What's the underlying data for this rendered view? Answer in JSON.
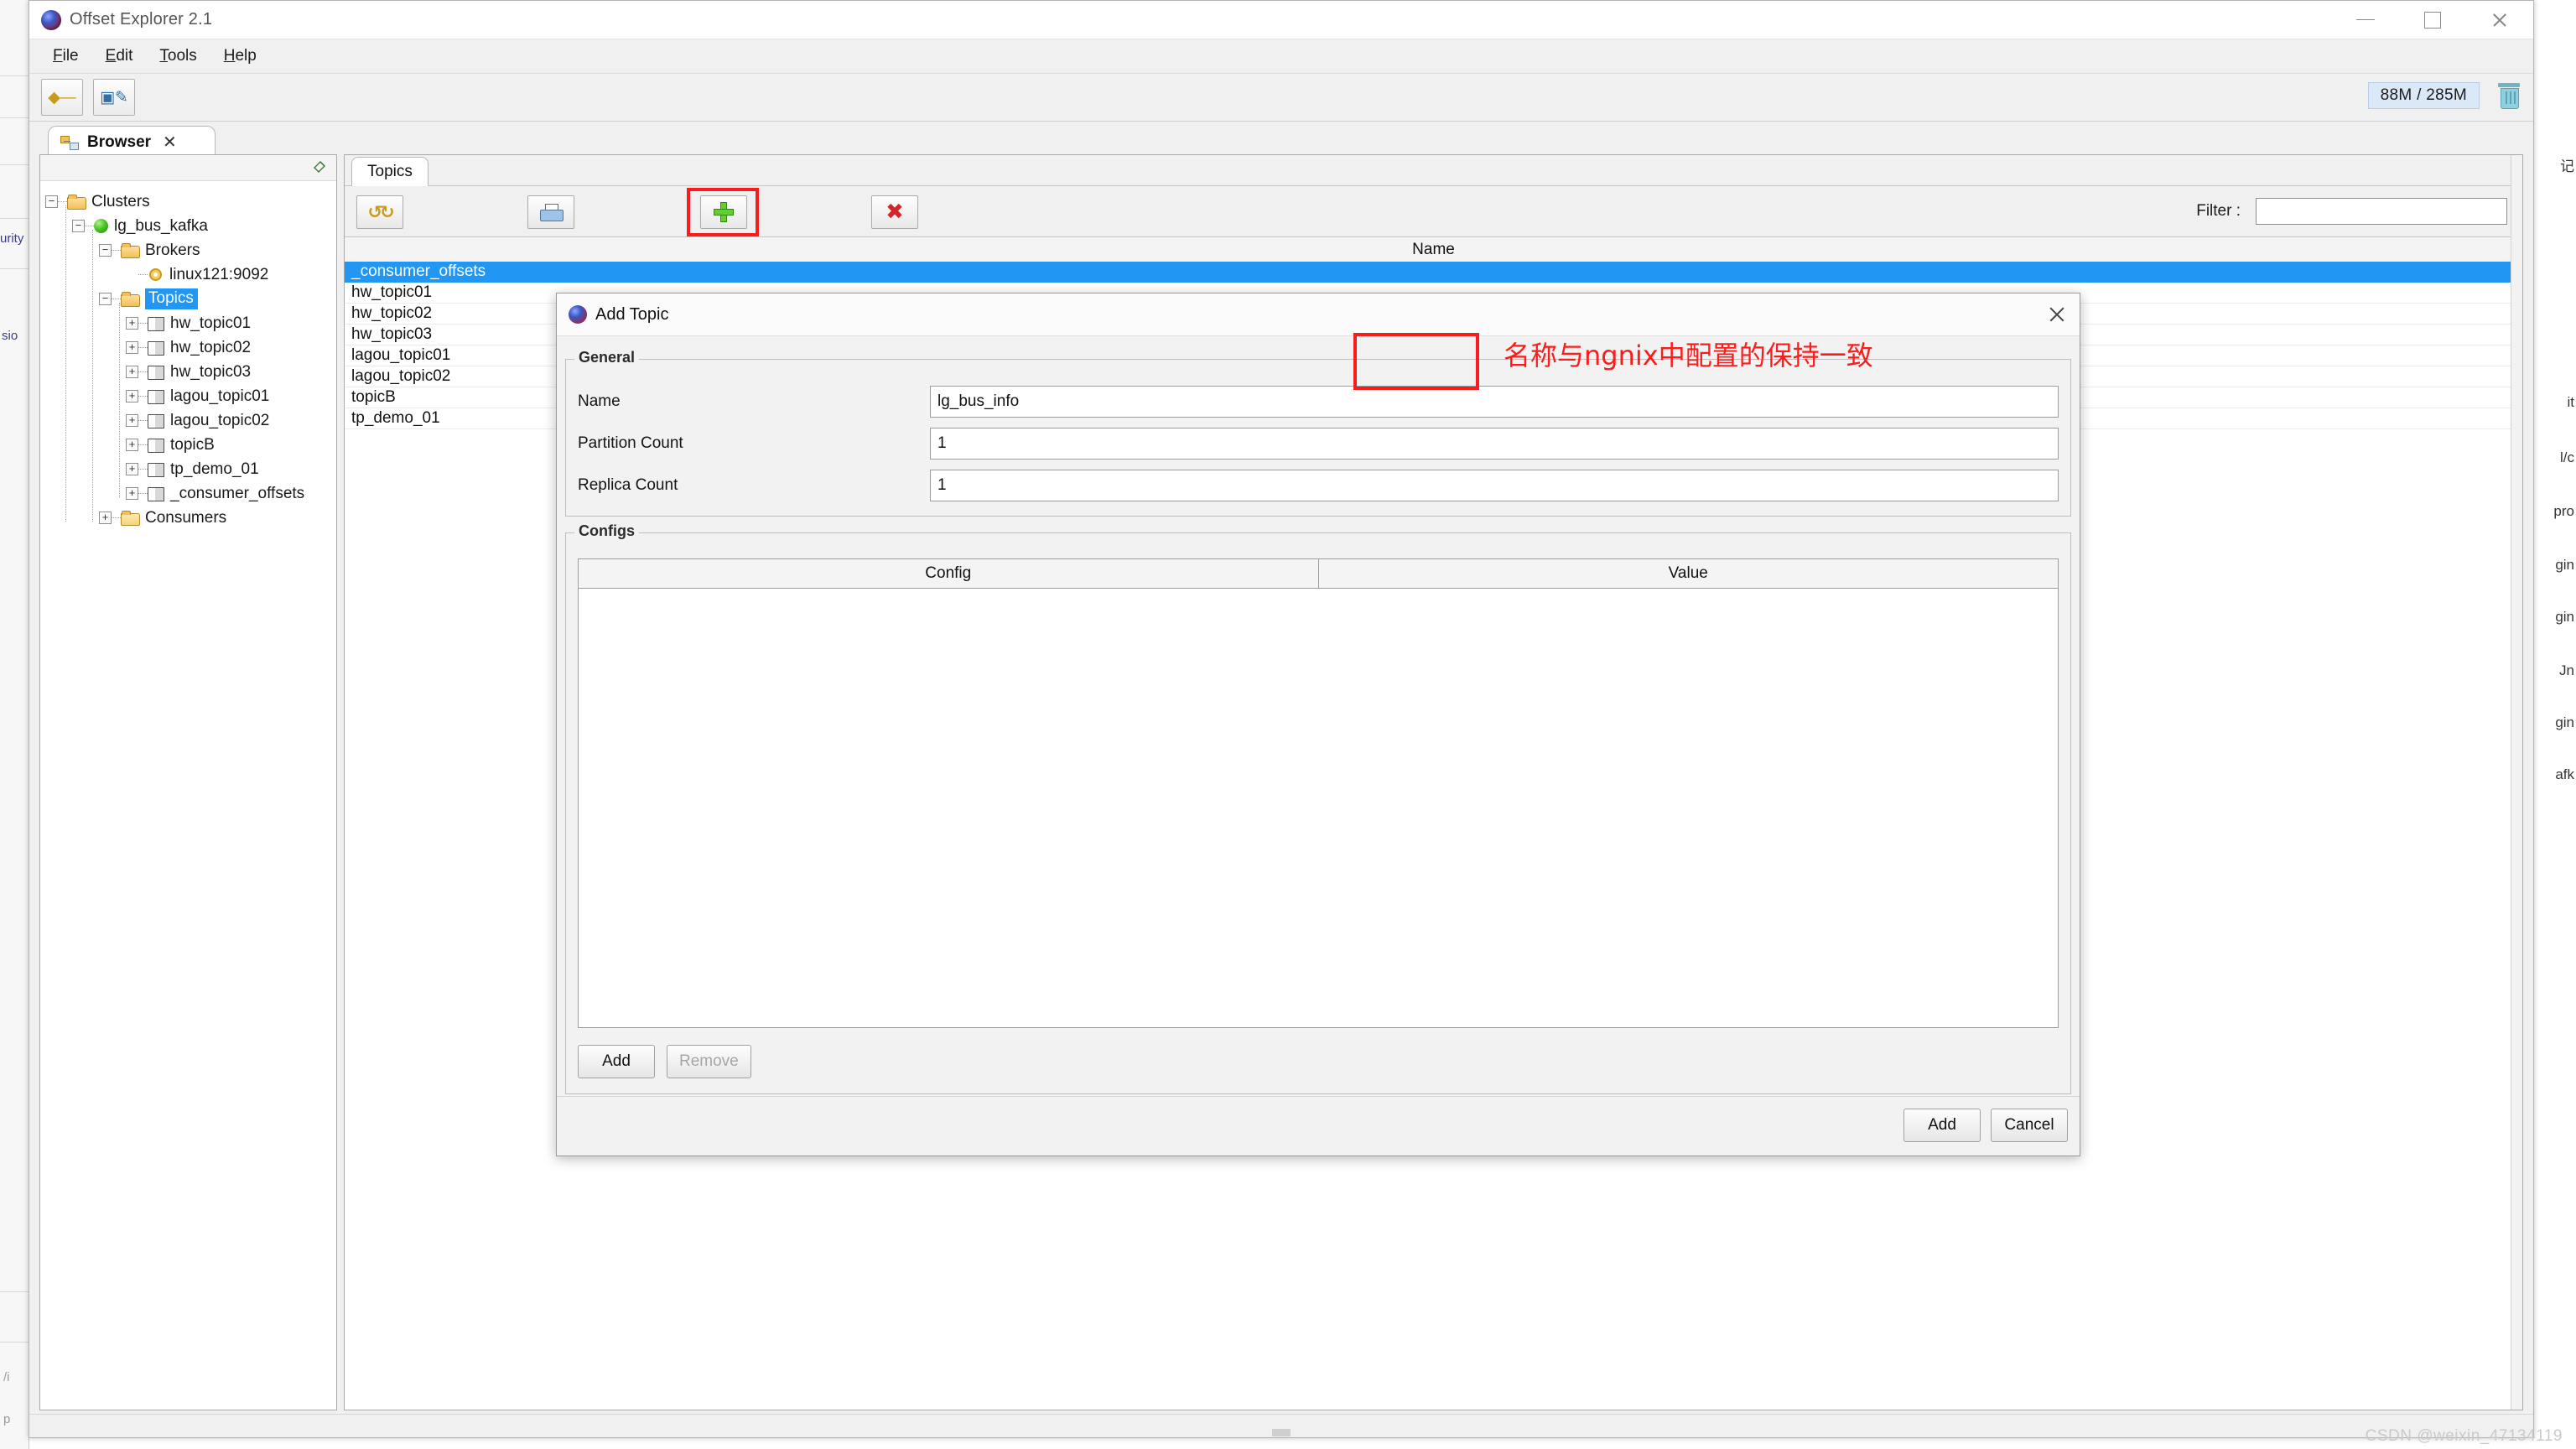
{
  "window": {
    "title": "Offset Explorer  2.1",
    "logo_icon": "app-orb-icon",
    "minimize_label": "Minimize",
    "maximize_label": "Maximize",
    "close_label": "Close"
  },
  "menubar": {
    "items": [
      {
        "label": "File",
        "mnemonic": "F"
      },
      {
        "label": "Edit",
        "mnemonic": "E"
      },
      {
        "label": "Tools",
        "mnemonic": "T"
      },
      {
        "label": "Help",
        "mnemonic": "H"
      }
    ]
  },
  "toolbar": {
    "buttons": [
      {
        "name": "add-cluster-button",
        "icon": "cluster-connect-icon"
      },
      {
        "name": "edit-cluster-button",
        "icon": "tree-edit-icon"
      }
    ],
    "memory": "88M / 285M",
    "trash_icon": "trash-icon"
  },
  "tabs": {
    "browser": {
      "label": "Browser",
      "icon": "browser-tree-icon",
      "close": "✕"
    }
  },
  "sidebar": {
    "pin_icon": "pin-icon",
    "tree": [
      {
        "label": "Clusters",
        "icon": "folder-icon",
        "expander": "−",
        "depth": 0
      },
      {
        "label": "lg_bus_kafka",
        "icon": "green-status-icon",
        "expander": "−",
        "depth": 1
      },
      {
        "label": "Brokers",
        "icon": "folder-icon",
        "expander": "−",
        "depth": 2
      },
      {
        "label": "linux121:9092",
        "icon": "gear-icon",
        "expander": "",
        "depth": 3
      },
      {
        "label": "Topics",
        "icon": "folder-icon",
        "expander": "−",
        "depth": 2,
        "selected": true
      },
      {
        "label": "hw_topic01",
        "icon": "topic-book-icon",
        "expander": "+",
        "depth": 3
      },
      {
        "label": "hw_topic02",
        "icon": "topic-book-icon",
        "expander": "+",
        "depth": 3
      },
      {
        "label": "hw_topic03",
        "icon": "topic-book-icon",
        "expander": "+",
        "depth": 3
      },
      {
        "label": "lagou_topic01",
        "icon": "topic-book-icon",
        "expander": "+",
        "depth": 3
      },
      {
        "label": "lagou_topic02",
        "icon": "topic-book-icon",
        "expander": "+",
        "depth": 3
      },
      {
        "label": "topicB",
        "icon": "topic-book-icon",
        "expander": "+",
        "depth": 3
      },
      {
        "label": "tp_demo_01",
        "icon": "topic-book-icon",
        "expander": "+",
        "depth": 3
      },
      {
        "label": "_consumer_offsets",
        "icon": "topic-book-icon",
        "expander": "+",
        "depth": 3
      },
      {
        "label": "Consumers",
        "icon": "folder-closed-icon",
        "expander": "+",
        "depth": 2
      }
    ]
  },
  "main": {
    "tab_label": "Topics",
    "toolbar": [
      {
        "name": "refresh-button",
        "icon": "refresh-icon"
      },
      {
        "name": "export-button",
        "icon": "printer-icon"
      },
      {
        "name": "add-topic-button",
        "icon": "plus-icon",
        "highlighted": true
      },
      {
        "name": "delete-topic-button",
        "icon": "red-x-icon"
      }
    ],
    "filter_label": "Filter :",
    "filter_value": "",
    "filter_placeholder": "",
    "grid": {
      "columns": [
        "Name"
      ],
      "rows": [
        {
          "name": "_consumer_offsets",
          "selected": true
        },
        {
          "name": "hw_topic01",
          "selected": false
        },
        {
          "name": "hw_topic02",
          "selected": false
        },
        {
          "name": "hw_topic03",
          "selected": false
        },
        {
          "name": "lagou_topic01",
          "selected": false
        },
        {
          "name": "lagou_topic02",
          "selected": false
        },
        {
          "name": "topicB",
          "selected": false
        },
        {
          "name": "tp_demo_01",
          "selected": false
        }
      ]
    }
  },
  "dialog": {
    "title": "Add Topic",
    "logo_icon": "app-orb-icon",
    "close_icon": "close-icon",
    "general_group": "General",
    "fields": [
      {
        "label": "Name",
        "value": "lg_bus_info",
        "highlighted": true
      },
      {
        "label": "Partition Count",
        "value": "1",
        "highlighted": false
      },
      {
        "label": "Replica Count",
        "value": "1",
        "highlighted": false
      }
    ],
    "configs_group": "Configs",
    "config_columns": [
      "Config",
      "Value"
    ],
    "config_rows": [],
    "config_buttons": [
      {
        "label": "Add",
        "enabled": true
      },
      {
        "label": "Remove",
        "enabled": false
      }
    ],
    "footer_buttons": [
      {
        "label": "Add",
        "enabled": true
      },
      {
        "label": "Cancel",
        "enabled": true
      }
    ]
  },
  "annotation": {
    "text": "名称与ngnix中配置的保持一致",
    "color": "#fc1c1c"
  },
  "background_window": {
    "left_fragments": [
      "urity",
      "sio",
      "/i",
      "p"
    ],
    "right_fragments": [
      "记",
      "it",
      "l/c",
      "pro",
      "gin",
      "gin",
      "Jn",
      "gin",
      "afk"
    ]
  },
  "watermark": "CSDN @weixin_47134119",
  "colors": {
    "accent": "#2196f3",
    "highlight_red": "#f91c1c",
    "annotation_red": "#fc1c1c",
    "status_green": "#49c524"
  }
}
